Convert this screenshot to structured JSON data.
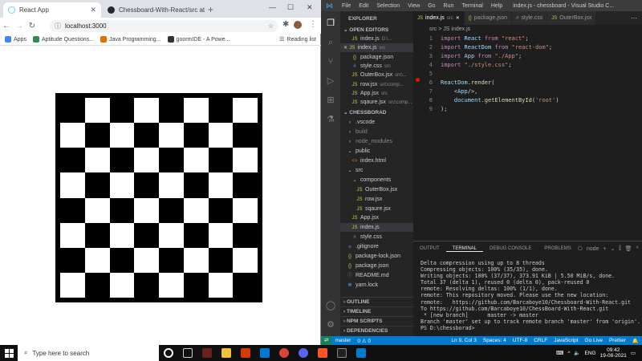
{
  "chrome": {
    "tabs": [
      {
        "title": "React App",
        "favicon_color": "#61dafb"
      },
      {
        "title": "Chessboard-With-React/src at m",
        "favicon_color": "#24292e"
      }
    ],
    "new_tab": "+",
    "url": "localhost:3000",
    "bookmarks": [
      {
        "label": "Apps",
        "color": "#4285f4"
      },
      {
        "label": "Aptitude Questions...",
        "color": "#2d8f4e"
      },
      {
        "label": "Java Programming...",
        "color": "#e76f00"
      },
      {
        "label": "goormIDE - A Powe...",
        "color": "#333"
      }
    ],
    "reading_list": "Reading list"
  },
  "chessboard": {
    "light_color": "#ffffff",
    "dark_color": "#000000",
    "rows": 8,
    "cols": 8
  },
  "vscode": {
    "title": "index.js - chessboard - Visual Studio C...",
    "menu": [
      "File",
      "Edit",
      "Selection",
      "View",
      "Go",
      "Run",
      "Terminal",
      "Help"
    ],
    "sidebar": {
      "explorer_label": "EXPLORER",
      "open_editors_label": "OPEN EDITORS",
      "open_editors": [
        {
          "icon": "JS",
          "name": "index.js",
          "path": "D:\\...",
          "color": "#cbcb41"
        },
        {
          "icon": "JS",
          "name": "index.js",
          "path": "src",
          "color": "#cbcb41",
          "selected": true
        },
        {
          "icon": "{}",
          "name": "package.json",
          "path": "",
          "color": "#cbcb41"
        },
        {
          "icon": "#",
          "name": "style.css",
          "path": "src",
          "color": "#519aba"
        },
        {
          "icon": "JS",
          "name": "OuterBox.jsx",
          "path": "src\\...",
          "color": "#cbcb41"
        },
        {
          "icon": "JS",
          "name": "row.jsx",
          "path": "src\\comp...",
          "color": "#cbcb41"
        },
        {
          "icon": "JS",
          "name": "App.jsx",
          "path": "src",
          "color": "#cbcb41"
        },
        {
          "icon": "JS",
          "name": "sqaure.jsx",
          "path": "src\\comp...",
          "color": "#cbcb41"
        }
      ],
      "project_label": "CHESSBORAD",
      "tree": [
        {
          "name": ".vscode",
          "indent": 1,
          "type": "folder"
        },
        {
          "name": "build",
          "indent": 1,
          "type": "folder"
        },
        {
          "name": "node_modules",
          "indent": 1,
          "type": "folder"
        },
        {
          "name": "public",
          "indent": 1,
          "type": "folder-open"
        },
        {
          "name": "index.html",
          "indent": 2,
          "type": "html"
        },
        {
          "name": "src",
          "indent": 1,
          "type": "folder-open"
        },
        {
          "name": "components",
          "indent": 2,
          "type": "folder-open"
        },
        {
          "name": "OuterBox.jsx",
          "indent": 3,
          "type": "js"
        },
        {
          "name": "row.jsx",
          "indent": 3,
          "type": "js"
        },
        {
          "name": "sqaure.jsx",
          "indent": 3,
          "type": "js"
        },
        {
          "name": "App.jsx",
          "indent": 2,
          "type": "js"
        },
        {
          "name": "index.js",
          "indent": 2,
          "type": "js",
          "selected": true
        },
        {
          "name": "style.css",
          "indent": 2,
          "type": "css"
        },
        {
          "name": ".gitignore",
          "indent": 1,
          "type": "git"
        },
        {
          "name": "package-lock.json",
          "indent": 1,
          "type": "json"
        },
        {
          "name": "package.json",
          "indent": 1,
          "type": "json"
        },
        {
          "name": "README.md",
          "indent": 1,
          "type": "md"
        },
        {
          "name": "yarn.lock",
          "indent": 1,
          "type": "yarn"
        }
      ],
      "bottom_sections": [
        "OUTLINE",
        "TIMELINE",
        "NPM SCRIPTS",
        "DEPENDENCIES"
      ]
    },
    "editor_tabs": [
      {
        "name": "index.js",
        "path": "src",
        "active": true,
        "icon": "JS",
        "color": "#cbcb41"
      },
      {
        "name": "package.json",
        "path": "",
        "active": false,
        "icon": "{}",
        "color": "#cbcb41"
      },
      {
        "name": "style.css",
        "path": "",
        "active": false,
        "icon": "#",
        "color": "#519aba"
      },
      {
        "name": "OuterBox.jsx",
        "path": "",
        "active": false,
        "icon": "JS",
        "color": "#cbcb41"
      }
    ],
    "breadcrumb": "src > JS index.js",
    "code_lines": [
      {
        "n": "1",
        "text": "import React from \"react\";"
      },
      {
        "n": "2",
        "text": "import ReactDom from \"react-dom\";"
      },
      {
        "n": "3",
        "text": "import App from \"./App\";"
      },
      {
        "n": "4",
        "text": "import \"./style.css\";"
      },
      {
        "n": "5",
        "text": ""
      },
      {
        "n": "6",
        "text": "ReactDom.render("
      },
      {
        "n": "7",
        "text": "    <App/>,"
      },
      {
        "n": "8",
        "text": "    document.getElementById('root')"
      },
      {
        "n": "9",
        "text": ");"
      }
    ],
    "panel_tabs": [
      "OUTPUT",
      "TERMINAL",
      "DEBUG CONSOLE",
      "PROBLEMS"
    ],
    "terminal_shell": "node",
    "terminal_lines": [
      "Delta compression using up to 8 threads",
      "Compressing objects: 100% (35/35), done.",
      "Writing objects: 100% (37/37), 373.91 KiB | 5.50 MiB/s, done.",
      "Total 37 (delta 1), reused 0 (delta 0), pack-reused 0",
      "remote: Resolving deltas: 100% (1/1), done.",
      "remote: This repository moved. Please use the new location:",
      "remote:   https://github.com/Barcaboye10/Chessboard-With-React.git",
      "To https://github.com/Barcaboye10/ChessBoard-With-React.git",
      " * [new branch]      master -> master",
      "Branch 'master' set up to track remote branch 'master' from 'origin'.",
      "PS D:\\chessborad> "
    ],
    "status_left": [
      "master",
      "0 ⚠ 0"
    ],
    "status_right": [
      "Ln 9, Col 3",
      "Spaces: 4",
      "UTF-8",
      "CRLF",
      "JavaScript",
      "Go Live",
      "Prettier"
    ]
  },
  "taskbar": {
    "search_placeholder": "Type here to search",
    "lang": "ENG",
    "time": "09:42",
    "date": "19-08-2021"
  }
}
